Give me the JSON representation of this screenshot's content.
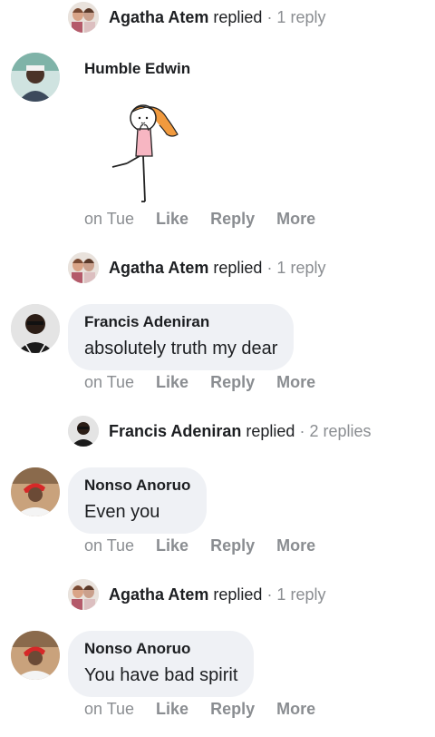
{
  "comments": [
    {
      "reply_summary": {
        "name": "Agatha Atem",
        "verb": "replied",
        "count": "· 1 reply"
      }
    },
    {
      "author": "Humble Edwin",
      "sticker": "cartoon-girl-sticker",
      "time": "on Tue",
      "like": "Like",
      "reply": "Reply",
      "more": "More",
      "reply_summary": {
        "name": "Agatha Atem",
        "verb": "replied",
        "count": "· 1 reply"
      }
    },
    {
      "author": "Francis Adeniran",
      "text": "absolutely truth my dear",
      "time": "on Tue",
      "like": "Like",
      "reply": "Reply",
      "more": "More",
      "reply_summary": {
        "name": "Francis Adeniran",
        "verb": "replied",
        "count": "· 2 replies"
      }
    },
    {
      "author": "Nonso Anoruo",
      "text": "Even you",
      "time": "on Tue",
      "like": "Like",
      "reply": "Reply",
      "more": "More",
      "reply_summary": {
        "name": "Agatha Atem",
        "verb": "replied",
        "count": "· 1 reply"
      }
    },
    {
      "author": "Nonso Anoruo",
      "text": "You have bad spirit",
      "time": "on Tue",
      "like": "Like",
      "reply": "Reply",
      "more": "More"
    }
  ]
}
